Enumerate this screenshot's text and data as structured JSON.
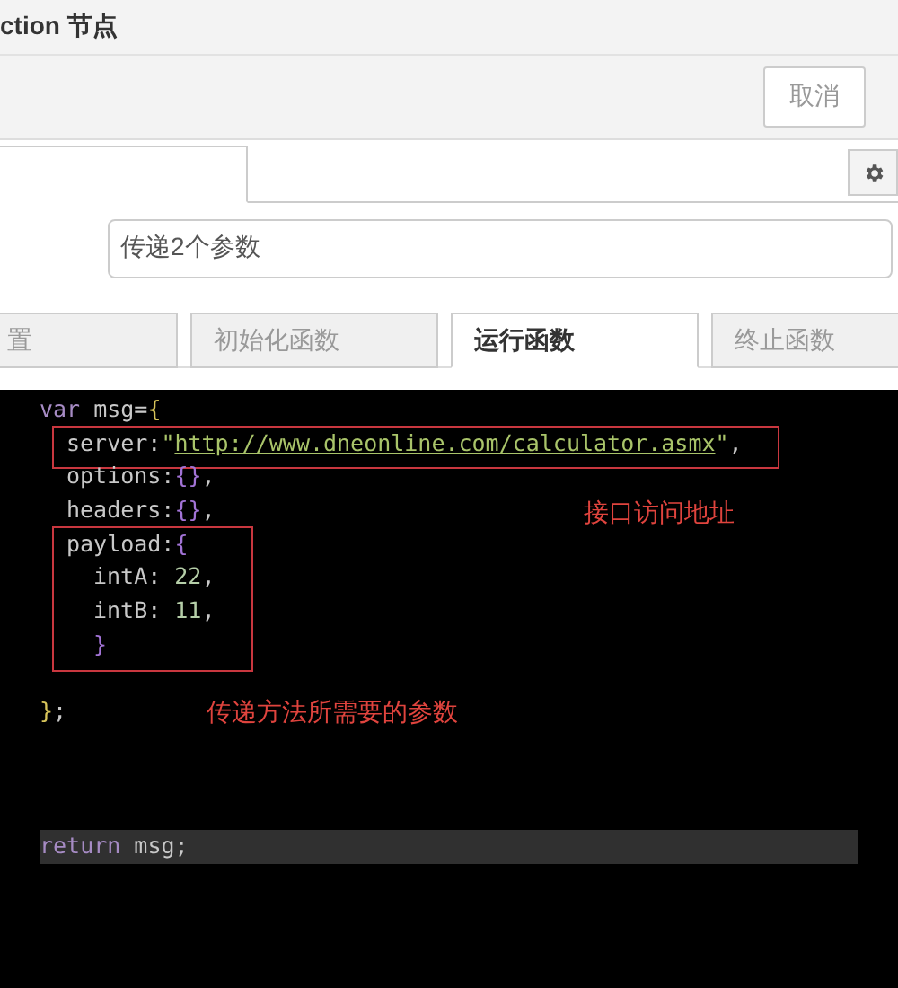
{
  "window": {
    "title": "ction 节点"
  },
  "toolbar": {
    "buttons": [
      {
        "label": "取消"
      }
    ]
  },
  "node_tabs": [
    {
      "selected": true
    }
  ],
  "name_field": {
    "value": "传递2个参数"
  },
  "function_tabs": [
    {
      "label": "置",
      "selected": false
    },
    {
      "label": "初始化函数",
      "selected": false
    },
    {
      "label": "运行函数",
      "selected": true
    },
    {
      "label": "终止函数",
      "selected": false
    }
  ],
  "code": {
    "lines": [
      {
        "kind": "code",
        "active": false,
        "segments": [
          {
            "text": "var",
            "kind": "keyword"
          },
          {
            "text": " msg=",
            "kind": "plain"
          },
          {
            "text": "{",
            "kind": "brace_outer"
          }
        ],
        "children": [
          {
            "kind": "code",
            "active": false,
            "boxed": true,
            "segments": [
              {
                "text": "server:",
                "kind": "plain"
              },
              {
                "text": "\"",
                "kind": "string"
              },
              {
                "text": "http://www.dneonline.com/calculator.asmx",
                "kind": "url"
              },
              {
                "text": "\"",
                "kind": "string"
              },
              {
                "text": ",",
                "kind": "plain"
              }
            ]
          },
          {
            "kind": "code",
            "active": false,
            "segments": [
              {
                "text": "options:",
                "kind": "plain"
              },
              {
                "text": "{}",
                "kind": "brace_inner"
              },
              {
                "text": ",",
                "kind": "plain"
              }
            ]
          },
          {
            "kind": "code",
            "active": false,
            "segments": [
              {
                "text": "headers:",
                "kind": "plain"
              },
              {
                "text": "{}",
                "kind": "brace_inner"
              },
              {
                "text": ",",
                "kind": "plain"
              }
            ]
          },
          {
            "kind": "code",
            "active": false,
            "boxed": true,
            "segments": [
              {
                "text": "payload:",
                "kind": "plain"
              },
              {
                "text": "{",
                "kind": "brace_inner"
              }
            ],
            "children": [
              {
                "kind": "code",
                "active": false,
                "segments": [
                  {
                    "text": "intA: ",
                    "kind": "plain"
                  },
                  {
                    "text": "22",
                    "kind": "number"
                  },
                  {
                    "text": ",",
                    "kind": "plain"
                  }
                ]
              },
              {
                "kind": "code",
                "active": false,
                "segments": [
                  {
                    "text": "intB: ",
                    "kind": "plain"
                  },
                  {
                    "text": "11",
                    "kind": "number"
                  },
                  {
                    "text": ",",
                    "kind": "plain"
                  }
                ]
              },
              {
                "kind": "code",
                "active": false,
                "segments": [
                  {
                    "text": "}",
                    "kind": "brace_inner"
                  }
                ]
              }
            ]
          }
        ]
      },
      {
        "kind": "blank"
      },
      {
        "kind": "code",
        "active": false,
        "segments": [
          {
            "text": "}",
            "kind": "brace_outer"
          },
          {
            "text": ";",
            "kind": "plain"
          }
        ]
      },
      {
        "kind": "blank"
      },
      {
        "kind": "blank"
      },
      {
        "kind": "blank"
      },
      {
        "kind": "code",
        "active": true,
        "segments": [
          {
            "text": "return",
            "kind": "keyword"
          },
          {
            "text": " msg;",
            "kind": "plain"
          }
        ]
      }
    ]
  },
  "annotations": [
    {
      "text": "接口访问地址"
    },
    {
      "text": "传递方法所需要的参数"
    }
  ]
}
